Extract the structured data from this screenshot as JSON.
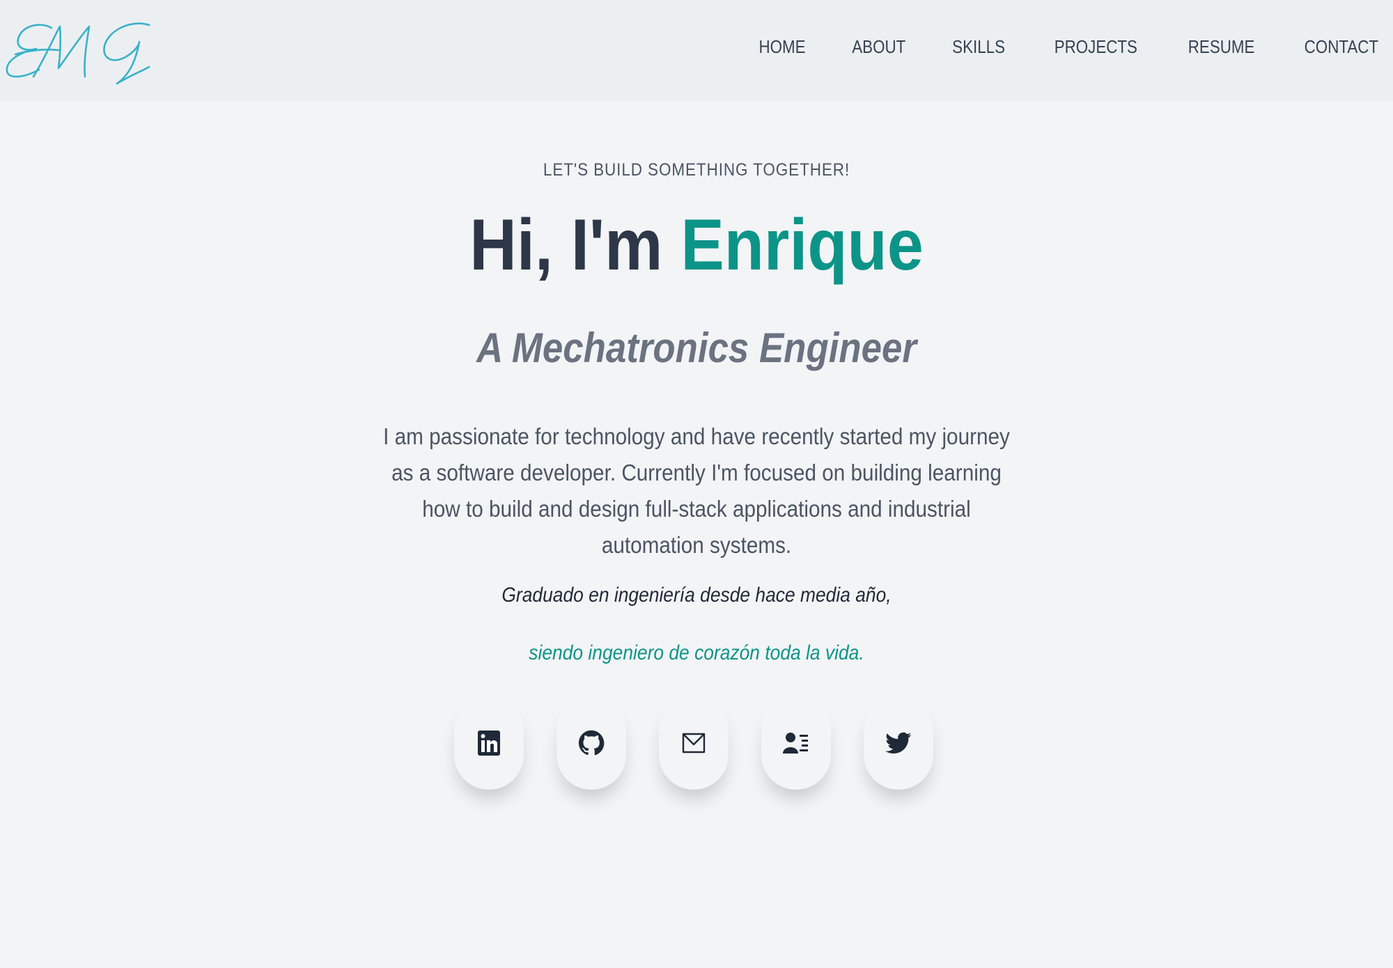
{
  "header": {
    "logo_text": "EMG",
    "nav": [
      {
        "label": "HOME"
      },
      {
        "label": "ABOUT"
      },
      {
        "label": "SKILLS"
      },
      {
        "label": "PROJECTS"
      },
      {
        "label": "RESUME"
      },
      {
        "label": "CONTACT"
      }
    ]
  },
  "hero": {
    "eyebrow": "LET'S BUILD SOMETHING TOGETHER!",
    "greeting": "Hi, I'm ",
    "name": "Enrique",
    "role": "A Mechatronics Engineer",
    "bio": "I am passionate for technology and have recently started my journey as a software developer. Currently I'm focused on building learning how to build and design full-stack applications and industrial automation systems.",
    "quote_line1": "Graduado en ingeniería desde hace media año,",
    "quote_line2": "siendo ingeniero de corazón toda la vida."
  },
  "socials": [
    {
      "icon": "linkedin-icon"
    },
    {
      "icon": "github-icon"
    },
    {
      "icon": "mail-icon"
    },
    {
      "icon": "contact-card-icon"
    },
    {
      "icon": "twitter-icon"
    }
  ],
  "colors": {
    "background": "#f3f4f6",
    "navbar": "#eceff2",
    "accent": "#0d9488",
    "heading": "#2d3748",
    "muted": "#6b7280",
    "logo": "#38b2c8"
  }
}
